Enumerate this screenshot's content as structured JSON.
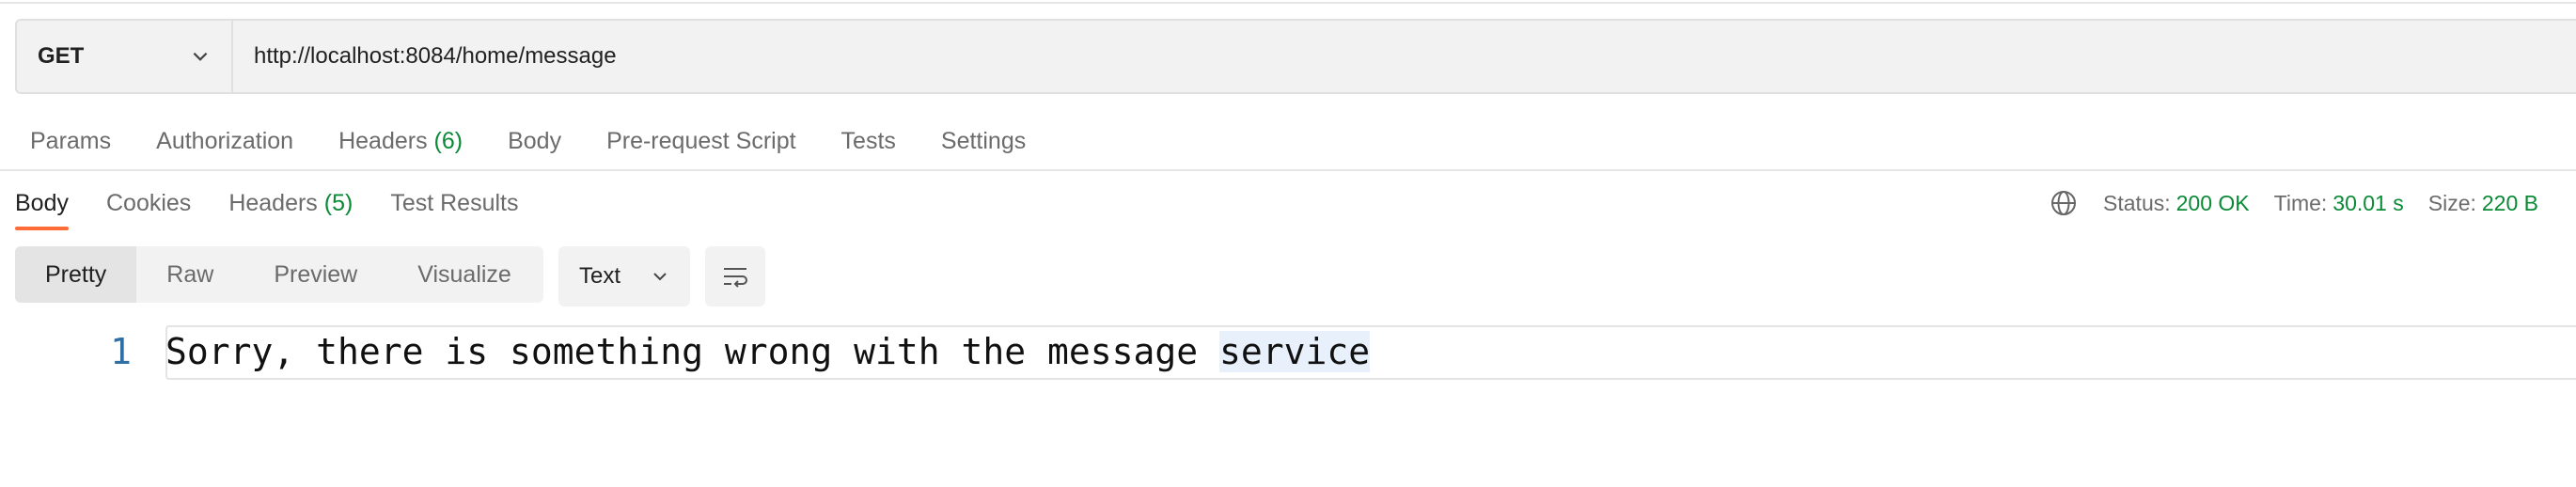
{
  "request": {
    "method": "GET",
    "url": "http://localhost:8084/home/message"
  },
  "request_tabs": [
    {
      "label": "Params",
      "count": ""
    },
    {
      "label": "Authorization",
      "count": ""
    },
    {
      "label": "Headers",
      "count": "(6)"
    },
    {
      "label": "Body",
      "count": ""
    },
    {
      "label": "Pre-request Script",
      "count": ""
    },
    {
      "label": "Tests",
      "count": ""
    },
    {
      "label": "Settings",
      "count": ""
    }
  ],
  "response_tabs": [
    {
      "label": "Body",
      "count": "",
      "active": true
    },
    {
      "label": "Cookies",
      "count": ""
    },
    {
      "label": "Headers",
      "count": "(5)"
    },
    {
      "label": "Test Results",
      "count": ""
    }
  ],
  "status": {
    "status_label": "Status:",
    "status_value": "200 OK",
    "time_label": "Time:",
    "time_value": "30.01 s",
    "size_label": "Size:",
    "size_value": "220 B"
  },
  "view_modes": [
    "Pretty",
    "Raw",
    "Preview",
    "Visualize"
  ],
  "format": "Text",
  "code": {
    "line_number": "1",
    "text_main": "Sorry, there is something wrong with the message ",
    "text_highlight": "service"
  },
  "icons": {
    "method_chevron": "chevron-down-icon",
    "globe": "globe-icon",
    "format_chevron": "chevron-down-icon",
    "wrap": "word-wrap-icon"
  },
  "colors": {
    "accent": "#ff6c37",
    "success": "#0a8a36",
    "line_number": "#2f6fa3"
  }
}
